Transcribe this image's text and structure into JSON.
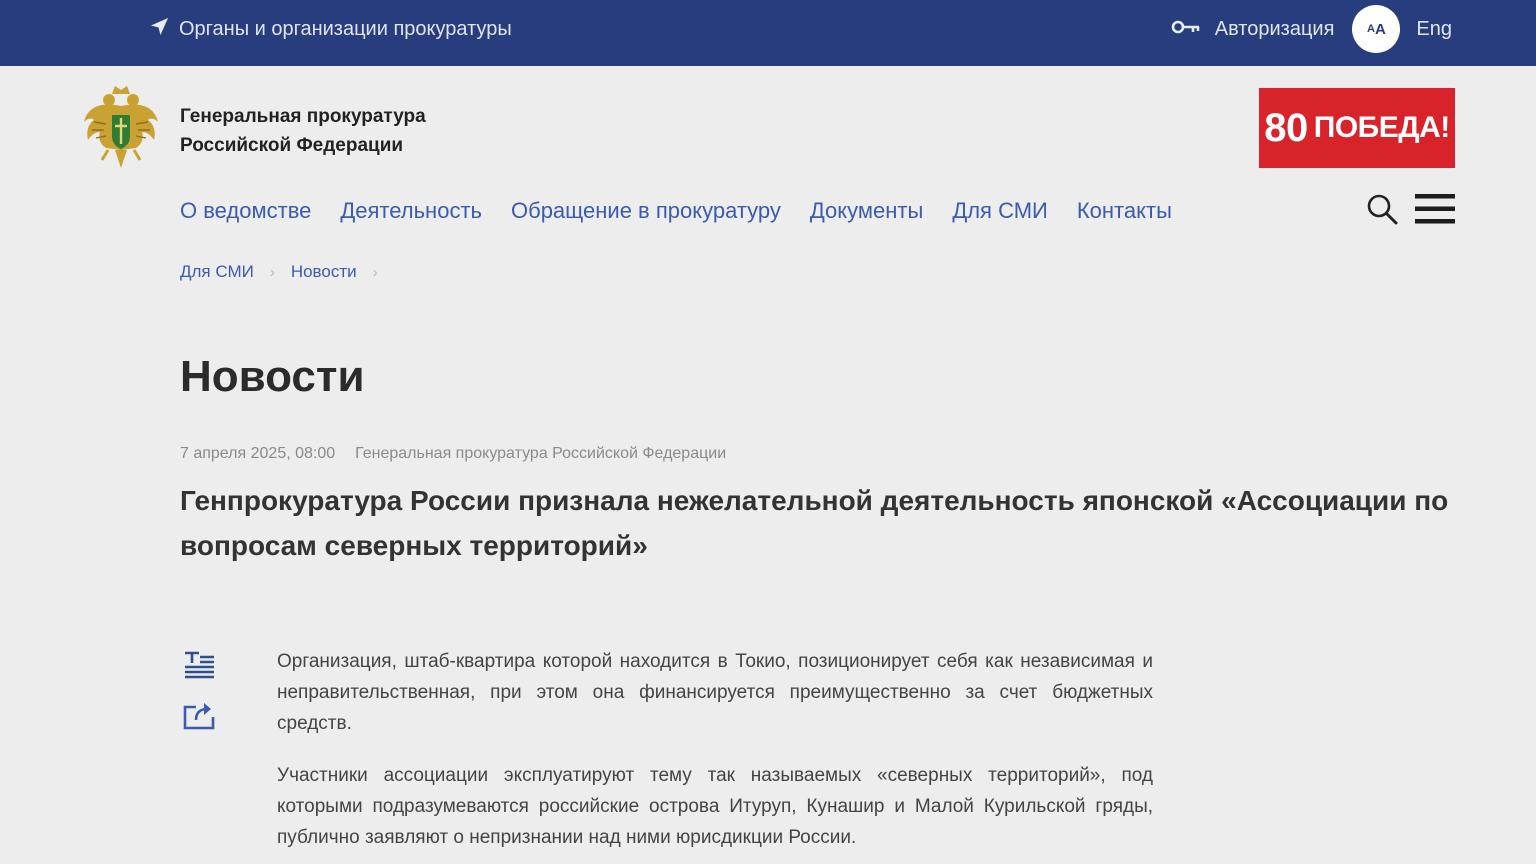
{
  "topbar": {
    "organizations_link": "Органы и организации прокуратуры",
    "auth_label": "Авторизация",
    "font_size_small": "A",
    "font_size_large": "A",
    "lang_label": "Eng"
  },
  "header": {
    "brand_line1": "Генеральная прокуратура",
    "brand_line2": "Российской Федерации",
    "victory_number": "80",
    "victory_text": "ПОБЕДА!"
  },
  "nav": {
    "items": [
      {
        "label": "О ведомстве"
      },
      {
        "label": "Деятельность"
      },
      {
        "label": "Обращение в прокуратуру"
      },
      {
        "label": "Документы"
      },
      {
        "label": "Для СМИ"
      },
      {
        "label": "Контакты"
      }
    ]
  },
  "breadcrumb": {
    "items": [
      {
        "label": "Для СМИ"
      },
      {
        "label": "Новости"
      }
    ],
    "separator": "›"
  },
  "page": {
    "title": "Новости"
  },
  "article": {
    "date": "7 апреля 2025, 08:00",
    "source": "Генеральная прокуратура Российской Федерации",
    "headline": "Генпрокуратура России признала нежелательной деятельность японской «Ассоциации по вопросам северных территорий»",
    "paragraphs": [
      "Организация, штаб-квартира которой находится в Токио, позиционирует себя как независимая и неправительственная, при этом она финансируется преимущественно за счет бюджетных средств.",
      "Участники ассоциации эксплуатируют тему так называемых «северных территорий», под которыми подразумеваются российские острова Итуруп, Кунашир и Малой Курильской гряды, публично заявляют о непризнании над ними юрисдикции России."
    ]
  },
  "colors": {
    "topbar_bg": "#283d7e",
    "link": "#3a5bb0",
    "victory_bg": "#d8232a",
    "page_bg": "#ededed"
  },
  "icons": {
    "orgs": "navigation-arrow-icon",
    "auth": "key-icon",
    "search": "search-icon",
    "menu": "hamburger-menu-icon",
    "text_view": "text-lines-icon",
    "share": "share-icon",
    "emblem": "double-headed-eagle-emblem"
  }
}
